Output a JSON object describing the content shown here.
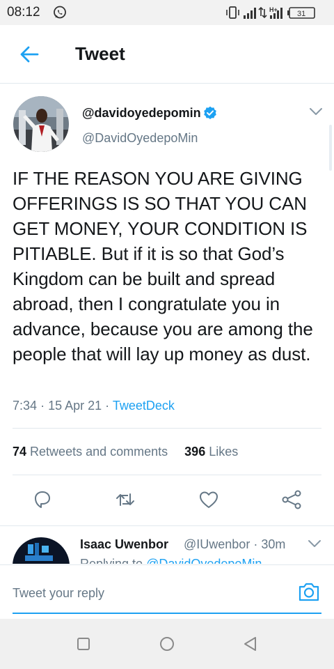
{
  "status_bar": {
    "time": "08:12",
    "network": "H+",
    "battery": "31",
    "icons": [
      "whatsapp-icon",
      "vibrate-icon",
      "signal-icon",
      "data-arrows-icon",
      "signal-icon",
      "battery-icon"
    ]
  },
  "header": {
    "title": "Tweet",
    "back_icon": "arrow-left-icon"
  },
  "tweet": {
    "display_name": "@davidoyedepomin",
    "handle": "@DavidOyedepoMin",
    "verified": true,
    "text": "IF THE REASON YOU ARE GIVING OFFERINGS IS SO THAT YOU CAN GET MONEY, YOUR CONDITION IS PITIABLE. But if it is so that God’s Kingdom can be built and spread abroad, then I congratulate you in advance, because you are among the people that will lay up money as dust.",
    "time": "7:34",
    "date": "15 Apr 21",
    "source": "TweetDeck",
    "retweets_count": "74",
    "retweets_label": "Retweets and comments",
    "likes_count": "396",
    "likes_label": "Likes"
  },
  "actions": [
    "reply-icon",
    "retweet-icon",
    "like-icon",
    "share-icon"
  ],
  "reply": {
    "name": "Isaac Uwenbor",
    "handle": "@IUwenbor",
    "time": "30m",
    "replying_prefix": "Replying to",
    "replying_handle": "@DavidOyedepoMin"
  },
  "composer": {
    "placeholder": "Tweet your reply",
    "camera_icon": "camera-icon"
  },
  "nav": [
    "recents-square-icon",
    "home-circle-icon",
    "back-triangle-icon"
  ],
  "colors": {
    "accent": "#1da1f2",
    "text": "#14171a",
    "muted": "#657786",
    "divider": "#e1e8ed"
  }
}
